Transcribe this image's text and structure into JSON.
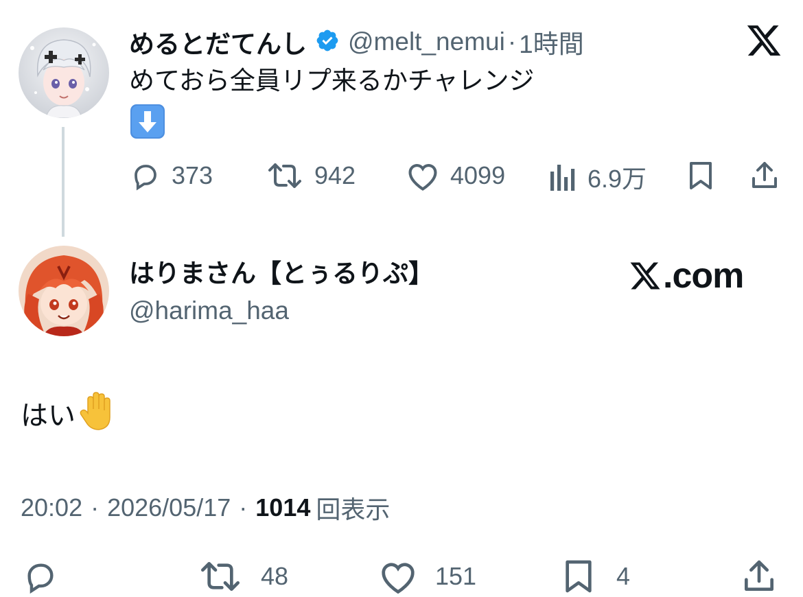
{
  "parent_tweet": {
    "author_name": "めるとだてんし",
    "handle": "@melt_nemui",
    "separator": "·",
    "time": "1時間",
    "text": "めておら全員リプ来るかチャレンジ",
    "emoji_down": "⬇️",
    "actions": {
      "replies": "373",
      "retweets": "942",
      "likes": "4099",
      "views": "6.9万"
    }
  },
  "reply_tweet": {
    "author_name": "はりまさん【とぅるりぷ】",
    "handle": "@harima_haa",
    "text": "はい",
    "emoji_hand": "✋",
    "timestamp": "20:02",
    "separator": "·",
    "date": "2026/05/17",
    "view_count": "1014",
    "view_label": "回表示",
    "actions": {
      "retweets": "48",
      "likes": "151",
      "bookmarks": "4"
    }
  },
  "branding": {
    "x_logo": "𝕏",
    "x_com": "X.com"
  },
  "colors": {
    "text_primary": "#0f1419",
    "text_secondary": "#536471",
    "verified_blue": "#1d9bf0",
    "thread_line": "#cfd9de"
  }
}
